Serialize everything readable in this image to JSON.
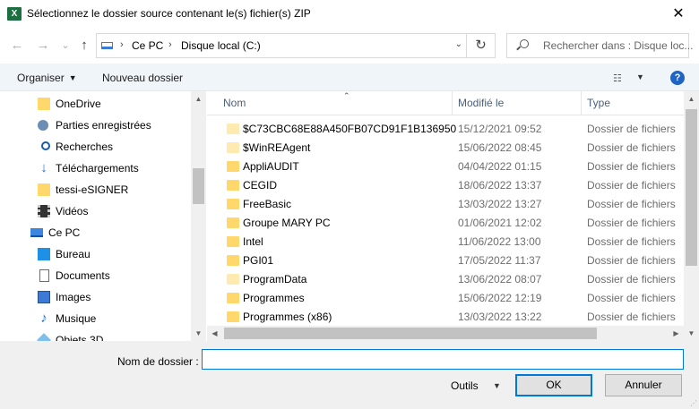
{
  "window": {
    "title": "Sélectionnez le dossier source contenant le(s) fichier(s) ZIP",
    "app_icon": "excel-icon",
    "close_glyph": "✕"
  },
  "nav": {
    "back_glyph": "←",
    "forward_glyph": "→",
    "history_glyph": "⌄",
    "up_glyph": "↑",
    "crumbs": [
      "Ce PC",
      "Disque local (C:)"
    ],
    "refresh_glyph": "↻",
    "search_placeholder": "Rechercher dans : Disque loc..."
  },
  "toolbar": {
    "organize_label": "Organiser",
    "new_folder_label": "Nouveau dossier",
    "view_icon": "details-view-icon",
    "help_label": "?"
  },
  "tree": [
    {
      "label": "OneDrive",
      "icon": "folder-icon"
    },
    {
      "label": "Parties enregistrées",
      "icon": "saved-games-icon"
    },
    {
      "label": "Recherches",
      "icon": "search-icon"
    },
    {
      "label": "Téléchargements",
      "icon": "downloads-icon"
    },
    {
      "label": "tessi-eSIGNER",
      "icon": "folder-icon"
    },
    {
      "label": "Vidéos",
      "icon": "videos-icon"
    },
    {
      "label": "Ce PC",
      "icon": "pc-icon"
    },
    {
      "label": "Bureau",
      "icon": "desktop-icon"
    },
    {
      "label": "Documents",
      "icon": "documents-icon"
    },
    {
      "label": "Images",
      "icon": "pictures-icon"
    },
    {
      "label": "Musique",
      "icon": "music-icon"
    },
    {
      "label": "Objets 3D",
      "icon": "3d-objects-icon"
    }
  ],
  "columns": {
    "name": "Nom",
    "modified": "Modifié le",
    "type": "Type"
  },
  "files": [
    {
      "name": "$C73CBC68E88A450FB07CD91F1B136950",
      "date": "15/12/2021 09:52",
      "type": "Dossier de fichiers"
    },
    {
      "name": "$WinREAgent",
      "date": "15/06/2022 08:45",
      "type": "Dossier de fichiers"
    },
    {
      "name": "AppliAUDIT",
      "date": "04/04/2022 01:15",
      "type": "Dossier de fichiers"
    },
    {
      "name": "CEGID",
      "date": "18/06/2022 13:37",
      "type": "Dossier de fichiers"
    },
    {
      "name": "FreeBasic",
      "date": "13/03/2022 13:27",
      "type": "Dossier de fichiers"
    },
    {
      "name": "Groupe MARY PC",
      "date": "01/06/2021 12:02",
      "type": "Dossier de fichiers"
    },
    {
      "name": "Intel",
      "date": "11/06/2022 13:00",
      "type": "Dossier de fichiers"
    },
    {
      "name": "PGI01",
      "date": "17/05/2022 11:37",
      "type": "Dossier de fichiers"
    },
    {
      "name": "ProgramData",
      "date": "13/06/2022 08:07",
      "type": "Dossier de fichiers"
    },
    {
      "name": "Programmes",
      "date": "15/06/2022 12:19",
      "type": "Dossier de fichiers"
    },
    {
      "name": "Programmes (x86)",
      "date": "13/03/2022 13:22",
      "type": "Dossier de fichiers"
    }
  ],
  "footer": {
    "folder_label": "Nom de dossier :",
    "folder_value": "",
    "tools_label": "Outils",
    "ok_label": "OK",
    "cancel_label": "Annuler"
  }
}
